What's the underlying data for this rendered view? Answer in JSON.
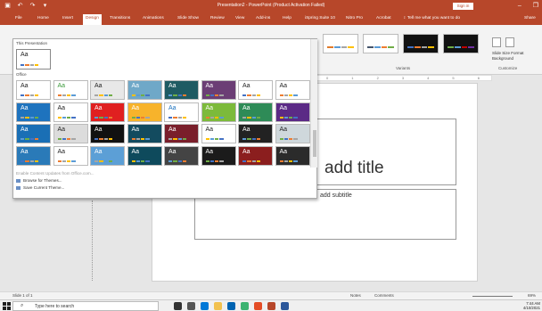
{
  "window": {
    "title": "Presentation2  -  PowerPoint (Product Activation Failed)",
    "sign_in": "Sign in",
    "minimize": "–",
    "restore": "❐",
    "close": "✕",
    "qat": [
      "save-icon",
      "undo-icon",
      "redo-icon",
      "customize-icon"
    ],
    "accent": "#b7472a"
  },
  "tabs": [
    {
      "label": "File"
    },
    {
      "label": "Home"
    },
    {
      "label": "Insert"
    },
    {
      "label": "Design",
      "active": true
    },
    {
      "label": "Transitions"
    },
    {
      "label": "Animations"
    },
    {
      "label": "Slide Show"
    },
    {
      "label": "Review"
    },
    {
      "label": "View"
    },
    {
      "label": "Add-ins"
    },
    {
      "label": "Help"
    },
    {
      "label": "iSpring Suite 10"
    },
    {
      "label": "Nitro Pro"
    },
    {
      "label": "Acrobat"
    },
    {
      "label": "Tell me what you want to do"
    },
    {
      "label": "Share"
    }
  ],
  "ribbon": {
    "variants_label": "Variants",
    "customize_label": "Customize",
    "slide_size": "Slide Size",
    "format_background": "Format Background"
  },
  "gallery": {
    "this_presentation": "This Presentation",
    "office": "Office",
    "current_theme_text": "Aa",
    "themes": [
      {
        "t": "Aa",
        "bg": "#ffffff",
        "fg": "#222"
      },
      {
        "t": "Aa",
        "bg": "#ffffff",
        "fg": "#3a9a3a"
      },
      {
        "t": "Aa",
        "bg": "#e8e8e8",
        "fg": "#222"
      },
      {
        "t": "Aa",
        "bg": "#6fa8c8",
        "fg": "#fff"
      },
      {
        "t": "Aa",
        "bg": "#1f5b63",
        "fg": "#fff"
      },
      {
        "t": "Aa",
        "bg": "#6b3e75",
        "fg": "#fff"
      },
      {
        "t": "Aa",
        "bg": "#ffffff",
        "fg": "#222"
      },
      {
        "t": "Aa",
        "bg": "#ffffff",
        "fg": "#222"
      },
      {
        "t": "Aa",
        "bg": "#1e73be",
        "fg": "#fff"
      },
      {
        "t": "Aa",
        "bg": "#ffffff",
        "fg": "#222"
      },
      {
        "t": "Aa",
        "bg": "#e02020",
        "fg": "#fff"
      },
      {
        "t": "Aa",
        "bg": "#f7b32b",
        "fg": "#fff"
      },
      {
        "t": "Aa",
        "bg": "#ffffff",
        "fg": "#1e73be"
      },
      {
        "t": "Aa",
        "bg": "#7cba3b",
        "fg": "#fff"
      },
      {
        "t": "Aa",
        "bg": "#2e8b57",
        "fg": "#fff"
      },
      {
        "t": "Aa",
        "bg": "#5b2a86",
        "fg": "#fff"
      },
      {
        "t": "Aa",
        "bg": "#1a6fb5",
        "fg": "#fff"
      },
      {
        "t": "Aa",
        "bg": "#dcdcdc",
        "fg": "#222"
      },
      {
        "t": "Aa",
        "bg": "#111111",
        "fg": "#fff"
      },
      {
        "t": "Aa",
        "bg": "#134b5f",
        "fg": "#fff"
      },
      {
        "t": "Aa",
        "bg": "#7a1f2b",
        "fg": "#fff"
      },
      {
        "t": "Aa",
        "bg": "#ffffff",
        "fg": "#222"
      },
      {
        "t": "Aa",
        "bg": "#222222",
        "fg": "#fff"
      },
      {
        "t": "Aa",
        "bg": "#cfd8dc",
        "fg": "#222"
      },
      {
        "t": "Aa",
        "bg": "#2a7ab8",
        "fg": "#fff"
      },
      {
        "t": "Aa",
        "bg": "#ffffff",
        "fg": "#222"
      },
      {
        "t": "Aa",
        "bg": "#5c9fd6",
        "fg": "#fff"
      },
      {
        "t": "Aa",
        "bg": "#0e4a5c",
        "fg": "#fff"
      },
      {
        "t": "Aa",
        "bg": "#444444",
        "fg": "#fff"
      },
      {
        "t": "Aa",
        "bg": "#1b1b1b",
        "fg": "#fff"
      },
      {
        "t": "Aa",
        "bg": "#8b1e1e",
        "fg": "#fff"
      },
      {
        "t": "Aa",
        "bg": "#2b2b2b",
        "fg": "#fff"
      }
    ],
    "menu": {
      "enable_updates": "Enable Content Updates from Office.com...",
      "browse": "Browse for Themes...",
      "save_current": "Save Current Theme..."
    }
  },
  "slide": {
    "title_placeholder": "add title",
    "subtitle_placeholder": "add subtitle"
  },
  "status": {
    "slide_info": "Slide 1 of 1",
    "notes": "Notes",
    "comments": "Comments",
    "zoom": "69%"
  },
  "taskbar": {
    "search_placeholder": "Type here to search",
    "time": "7:44 AM",
    "date": "4/10/2021"
  }
}
